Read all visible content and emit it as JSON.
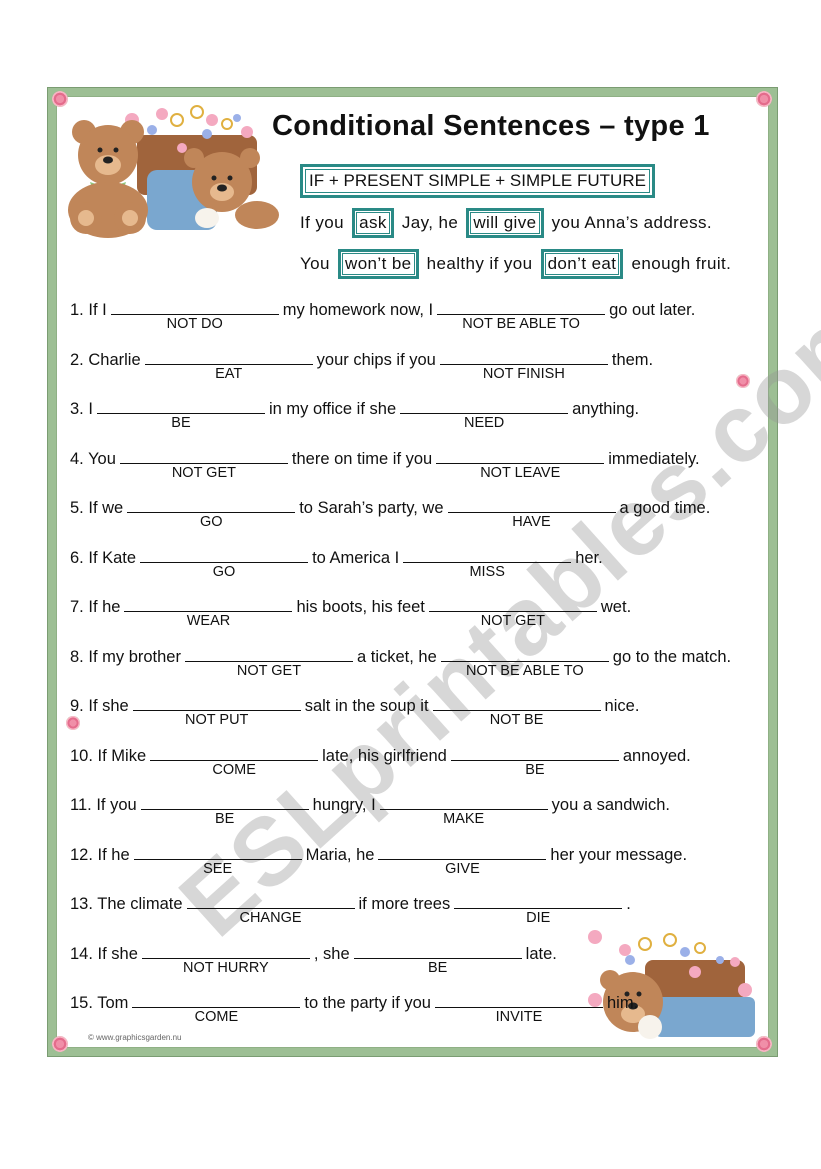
{
  "title": "Conditional Sentences – type 1",
  "formula": "IF + PRESENT SIMPLE + SIMPLE FUTURE",
  "examples": [
    {
      "before": "If you",
      "box1": "ask",
      "middle": "Jay, he",
      "box2": "will give",
      "after": "you Anna’s address."
    },
    {
      "before": "You",
      "box1": "won’t be",
      "middle": "healthy if you",
      "box2": "don’t eat",
      "after": "enough fruit."
    }
  ],
  "exercises": [
    {
      "num": "1.",
      "a": "If I",
      "h1": "NOT DO",
      "b": "my homework now, I",
      "h2": "NOT BE ABLE TO",
      "c": "go out later."
    },
    {
      "num": "2.",
      "a": "Charlie",
      "h1": "EAT",
      "b": "your chips if you",
      "h2": "NOT FINISH",
      "c": "them."
    },
    {
      "num": "3.",
      "a": "I",
      "h1": "BE",
      "b": "in my office if she",
      "h2": "NEED",
      "c": "anything."
    },
    {
      "num": "4.",
      "a": "You",
      "h1": "NOT GET",
      "b": "there on time if you",
      "h2": "NOT LEAVE",
      "c": "immediately."
    },
    {
      "num": "5.",
      "a": "If we",
      "h1": "GO",
      "b": "to Sarah’s party, we",
      "h2": "HAVE",
      "c": "a good time."
    },
    {
      "num": "6.",
      "a": "If Kate",
      "h1": "GO",
      "b": "to America I",
      "h2": "MISS",
      "c": "her."
    },
    {
      "num": "7.",
      "a": "If he",
      "h1": "WEAR",
      "b": "his boots, his feet",
      "h2": "NOT GET",
      "c": "wet."
    },
    {
      "num": "8.",
      "a": "If my brother",
      "h1": "NOT GET",
      "b": "a ticket, he",
      "h2": "NOT BE ABLE TO",
      "c": "go to the match."
    },
    {
      "num": "9.",
      "a": "If she",
      "h1": "NOT PUT",
      "b": "salt in the soup it",
      "h2": "NOT BE",
      "c": "nice."
    },
    {
      "num": "10.",
      "a": "If Mike",
      "h1": "COME",
      "b": "late, his girlfriend",
      "h2": "BE",
      "c": "annoyed."
    },
    {
      "num": "11.",
      "a": "If you",
      "h1": "BE",
      "b": "hungry, I",
      "h2": "MAKE",
      "c": "you a sandwich."
    },
    {
      "num": "12.",
      "a": "If he",
      "h1": "SEE",
      "b": "Maria, he",
      "h2": "GIVE",
      "c": "her your message."
    },
    {
      "num": "13.",
      "a": "The climate",
      "h1": "CHANGE",
      "b": "if more trees",
      "h2": "DIE",
      "c": "."
    },
    {
      "num": "14.",
      "a": "If she",
      "h1": "NOT HURRY",
      "b": ", she",
      "h2": "BE",
      "c": "late."
    },
    {
      "num": "15.",
      "a": "Tom",
      "h1": "COME",
      "b": "to the party if you",
      "h2": "INVITE",
      "c": "him."
    }
  ],
  "watermark": "ESLprintables.com",
  "copyright": "© www.graphicsgarden.nu",
  "colors": {
    "frame": "#9dbf94",
    "accent_box": "#2a8a86"
  }
}
